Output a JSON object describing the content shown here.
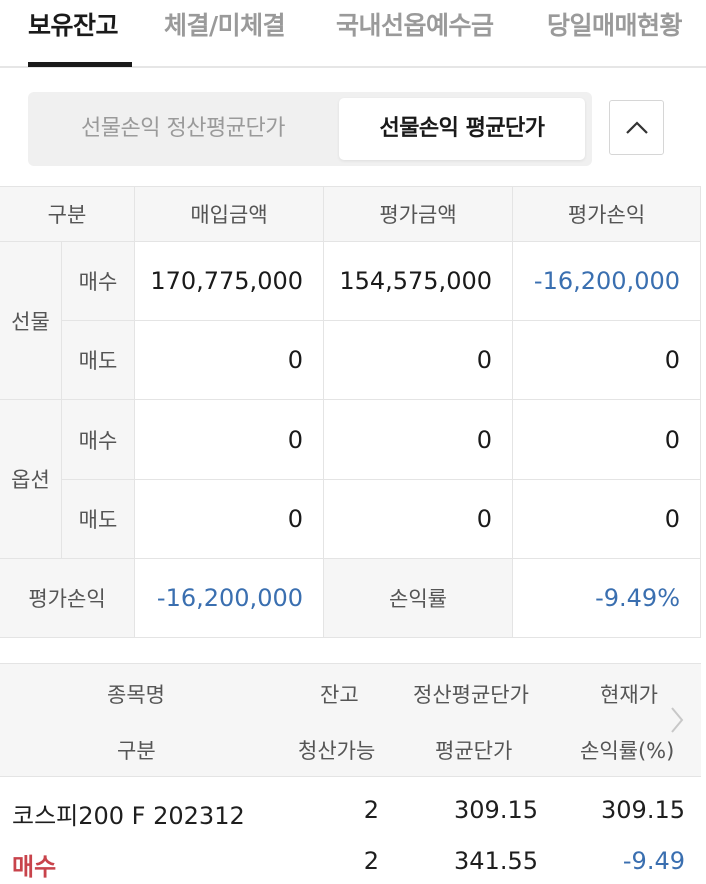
{
  "tabs": [
    {
      "label": "보유잔고",
      "active": true
    },
    {
      "label": "체결/미체결",
      "active": false
    },
    {
      "label": "국내선옵예수금",
      "active": false
    },
    {
      "label": "당일매매현황",
      "active": false
    }
  ],
  "segment": {
    "options": [
      "선물손익 정산평균단가",
      "선물손익 평균단가"
    ],
    "selected": "선물손익 평균단가"
  },
  "summary": {
    "headers": [
      "구분",
      "매입금액",
      "평가금액",
      "평가손익"
    ],
    "groups": [
      {
        "name": "선물",
        "rows": [
          {
            "side": "매수",
            "purchase": "170,775,000",
            "valuation": "154,575,000",
            "pnl": "-16,200,000"
          },
          {
            "side": "매도",
            "purchase": "0",
            "valuation": "0",
            "pnl": "0"
          }
        ]
      },
      {
        "name": "옵션",
        "rows": [
          {
            "side": "매수",
            "purchase": "0",
            "valuation": "0",
            "pnl": "0"
          },
          {
            "side": "매도",
            "purchase": "0",
            "valuation": "0",
            "pnl": "0"
          }
        ]
      }
    ],
    "total_pnl_label": "평가손익",
    "total_pnl": "-16,200,000",
    "rate_label": "손익률",
    "rate": "-9.49%"
  },
  "holdings": {
    "header_row1": [
      "종목명",
      "잔고",
      "정산평균단가",
      "현재가"
    ],
    "header_row2": [
      "구분",
      "청산가능",
      "평균단가",
      "손익률(%)"
    ],
    "rows": [
      {
        "name": "코스피200 F 202312",
        "balance": "2",
        "settle_avg": "309.15",
        "current": "309.15",
        "side": "매수",
        "closable": "2",
        "avg": "341.55",
        "rate": "-9.49"
      }
    ]
  },
  "colors": {
    "negative": "#3a6fb0",
    "buy": "#c8434b"
  }
}
